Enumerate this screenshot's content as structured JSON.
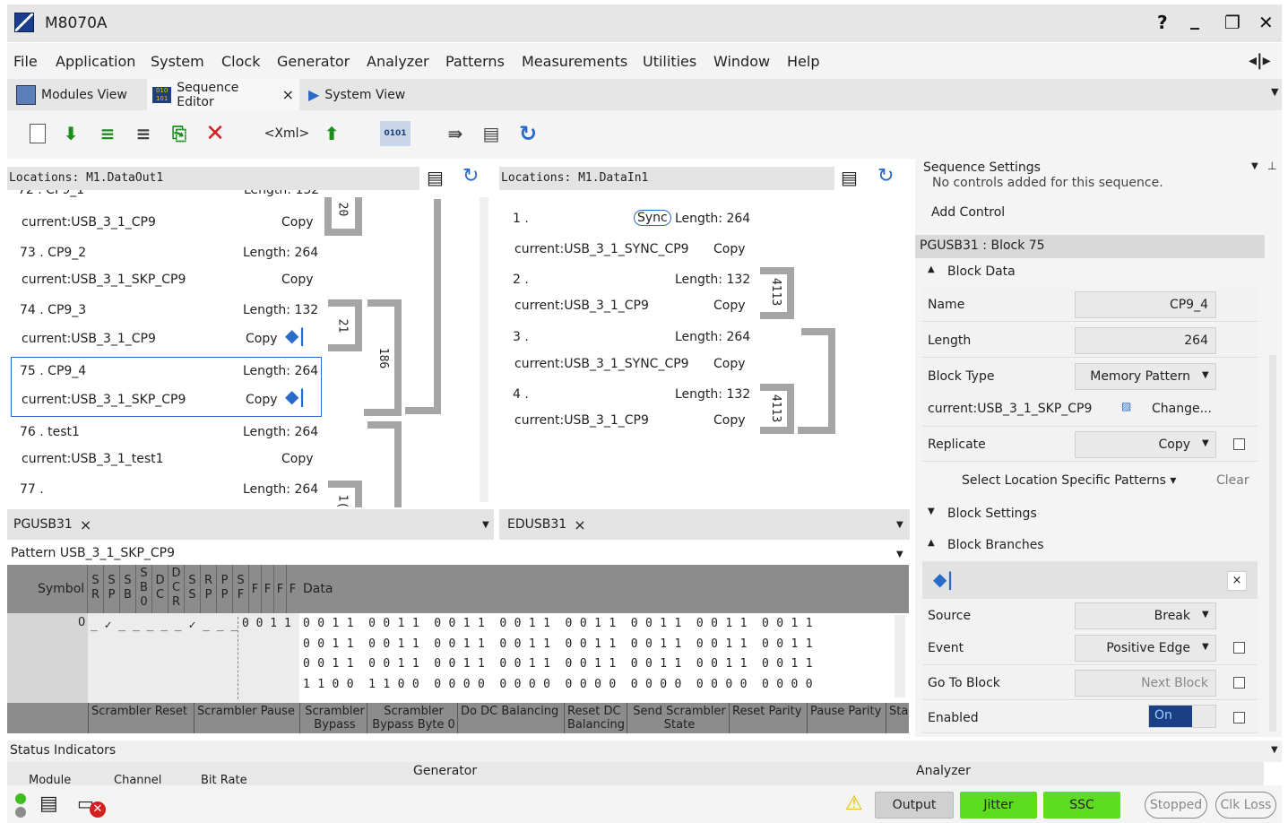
{
  "window": {
    "title": "M8070A",
    "help_btn": "?",
    "min_btn": "_",
    "max_btn": "❐",
    "close_btn": "✕"
  },
  "menu": [
    "File",
    "Application",
    "System",
    "Clock",
    "Generator",
    "Analyzer",
    "Patterns",
    "Measurements",
    "Utilities",
    "Window",
    "Help"
  ],
  "tabs": [
    {
      "label": "Modules View"
    },
    {
      "label": "Sequence Editor",
      "close": "×"
    },
    {
      "label": "System View"
    }
  ],
  "toolbar": {
    "xml_label": "<Xml>"
  },
  "left_panel": {
    "location": "Locations: M1.DataOut1",
    "rows": [
      {
        "idx": "72 . CP9_1",
        "len": "Length: 132",
        "pattern": "current:USB_3_1_CP9",
        "mode": "Copy"
      },
      {
        "idx": "73 . CP9_2",
        "len": "Length: 264",
        "pattern": "current:USB_3_1_SKP_CP9",
        "mode": "Copy"
      },
      {
        "idx": "74 . CP9_3",
        "len": "Length: 132",
        "pattern": "current:USB_3_1_CP9",
        "mode": "Copy"
      },
      {
        "idx": "75 . CP9_4",
        "len": "Length: 264",
        "pattern": "current:USB_3_1_SKP_CP9",
        "mode": "Copy"
      },
      {
        "idx": "76 . test1",
        "len": "Length: 264",
        "pattern": "current:USB_3_1_test1",
        "mode": "Copy"
      },
      {
        "idx": "77 .",
        "len": "Length: 264",
        "pattern": "",
        "mode": ""
      }
    ],
    "loop_labels": [
      "20",
      "21",
      "186",
      "1("
    ],
    "tab": "PGUSB31",
    "tab_close": "×"
  },
  "mid_panel": {
    "location": "Locations: M1.DataIn1",
    "rows": [
      {
        "idx": "1 .",
        "len": "Length: 264",
        "pattern": "current:USB_3_1_SYNC_CP9",
        "mode": "Copy",
        "sync": "Sync"
      },
      {
        "idx": "2 .",
        "len": "Length: 132",
        "pattern": "current:USB_3_1_CP9",
        "mode": "Copy"
      },
      {
        "idx": "3 .",
        "len": "Length: 264",
        "pattern": "current:USB_3_1_SYNC_CP9",
        "mode": "Copy"
      },
      {
        "idx": "4 .",
        "len": "Length: 132",
        "pattern": "current:USB_3_1_CP9",
        "mode": "Copy"
      }
    ],
    "loop_labels": [
      "4113",
      "4113"
    ],
    "tab": "EDUSB31",
    "tab_close": "×"
  },
  "settings": {
    "header": "Sequence Settings",
    "no_controls": "No controls added for this sequence.",
    "add_control": "Add Control",
    "block_header": "PGUSB31 : Block  75",
    "block_data": "Block Data",
    "name_label": "Name",
    "name_value": "CP9_4",
    "length_label": "Length",
    "length_value": "264",
    "type_label": "Block Type",
    "type_value": "Memory Pattern",
    "pattern_label": "current:USB_3_1_SKP_CP9",
    "change": "Change...",
    "replicate_label": "Replicate",
    "replicate_value": "Copy",
    "select_loc": "Select Location Specific Patterns ▾",
    "clear": "Clear",
    "block_settings": "Block Settings",
    "block_branches": "Block Branches",
    "branch_close": "×",
    "source_label": "Source",
    "source_value": "Break",
    "event_label": "Event",
    "event_value": "Positive Edge",
    "goto_label": "Go To Block",
    "goto_value": "Next Block",
    "enabled_label": "Enabled",
    "enabled_value": "On"
  },
  "pattern_panel": {
    "header": "Pattern USB_3_1_SKP_CP9",
    "symbol": "Symbol",
    "data_label": "Data",
    "col_heads": [
      "S R",
      "S P",
      "S B",
      "S B 0",
      "D C",
      "D C R",
      "S S",
      "R P",
      "P P",
      "S F",
      "F",
      "F",
      "F",
      "F"
    ],
    "row_index": "0",
    "check_row": "_ ✓ _ _ _ _ _ ✓ _ _ _",
    "lead": "0 0 1 1",
    "data_rows": [
      "0 0 1 1  0 0 1 1  0 0 1 1  0 0 1 1  0 0 1 1  0 0 1 1  0 0 1 1  0 0 1 1",
      "0 0 1 1  0 0 1 1  0 0 1 1  0 0 1 1  0 0 1 1  0 0 1 1  0 0 1 1  0 0 1 1",
      "0 0 1 1  0 0 1 1  0 0 1 1  0 0 1 1  0 0 1 1  0 0 1 1  0 0 1 1  0 0 1 1",
      "1 1 0 0  1 1 0 0  0 0 0 0  0 0 0 0  0 0 0 0  0 0 0 0  0 0 0 0  0 0 0 0"
    ],
    "footer": [
      "Scrambler Reset",
      "Scrambler Pause",
      "Scrambler Bypass",
      "Scrambler Bypass Byte 0",
      "Do DC Balancing",
      "Reset DC Balancing",
      "Send Scrambler State",
      "Reset Parity",
      "Pause Parity",
      "Sta"
    ]
  },
  "status": {
    "header": "Status Indicators",
    "generator": "Generator",
    "analyzer": "Analyzer",
    "col_module": "Module",
    "col_channel": "Channel",
    "col_bitrate": "Bit Rate",
    "output": "Output",
    "jitter": "Jitter",
    "ssc": "SSC",
    "stopped": "Stopped",
    "clk_loss": "Clk Loss"
  },
  "colors": {
    "green": "#5edc1f",
    "selection": "#1a3f85",
    "accent": "#2a6ac9"
  }
}
